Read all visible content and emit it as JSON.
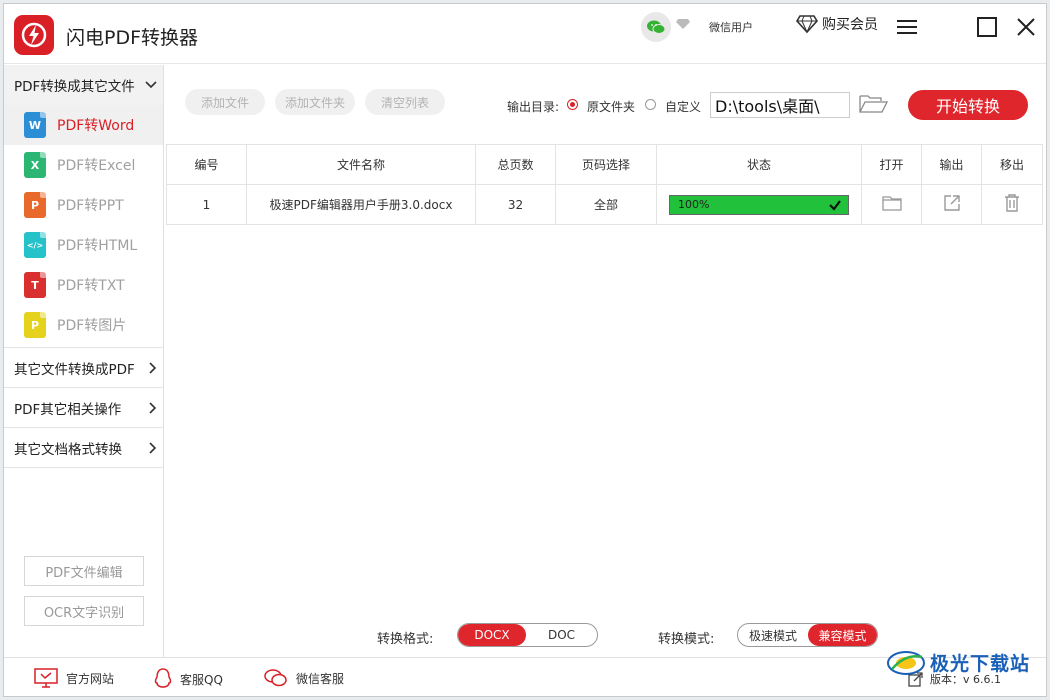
{
  "app": {
    "title": "闪电PDF转换器"
  },
  "header": {
    "user_name": "微信用户",
    "buy_vip": "购买会员"
  },
  "sidebar": {
    "section_main": {
      "label": "PDF转换成其它文件",
      "items": [
        {
          "label": "PDF转Word",
          "icon_letter": "W",
          "color": "#2c8fd6"
        },
        {
          "label": "PDF转Excel",
          "icon_letter": "X",
          "color": "#2bb673"
        },
        {
          "label": "PDF转PPT",
          "icon_letter": "P",
          "color": "#e8692a"
        },
        {
          "label": "PDF转HTML",
          "icon_letter": "</>",
          "color": "#26c2c9"
        },
        {
          "label": "PDF转TXT",
          "icon_letter": "T",
          "color": "#d92f2f"
        },
        {
          "label": "PDF转图片",
          "icon_letter": "P",
          "color": "#e5d21d"
        }
      ]
    },
    "sections": [
      {
        "label": "其它文件转换成PDF"
      },
      {
        "label": "PDF其它相关操作"
      },
      {
        "label": "其它文档格式转换"
      }
    ],
    "pdf_edit_button": "PDF文件编辑",
    "ocr_button": "OCR文字识别"
  },
  "toolbar": {
    "add_file": "添加文件",
    "add_folder": "添加文件夹",
    "clear_list": "清空列表",
    "output_label": "输出目录:",
    "original_folder": "原文件夹",
    "custom": "自定义",
    "path_value": "D:\\tools\\桌面\\",
    "start": "开始转换"
  },
  "table": {
    "headers": [
      "编号",
      "文件名称",
      "总页数",
      "页码选择",
      "状态",
      "打开",
      "输出",
      "移出"
    ],
    "rows": [
      {
        "num": "1",
        "name": "极速PDF编辑器用户手册3.0.docx",
        "pages": "32",
        "range": "全部",
        "progress_text": "100%",
        "progress": 1.0
      }
    ]
  },
  "format": {
    "label": "转换格式:",
    "options": [
      "DOCX",
      "DOC"
    ],
    "selected": "DOCX"
  },
  "mode": {
    "label": "转换模式:",
    "options": [
      "极速模式",
      "兼容模式"
    ],
    "selected": "兼容模式"
  },
  "footer": {
    "website": "官方网站",
    "qq": "客服QQ",
    "wechat": "微信客服",
    "version": "版本：v 6.6.1"
  },
  "watermark": {
    "text": "极光下载站"
  },
  "colors": {
    "accent": "#d92027",
    "progress": "#21c13b",
    "watermark": "#1a60b8"
  }
}
